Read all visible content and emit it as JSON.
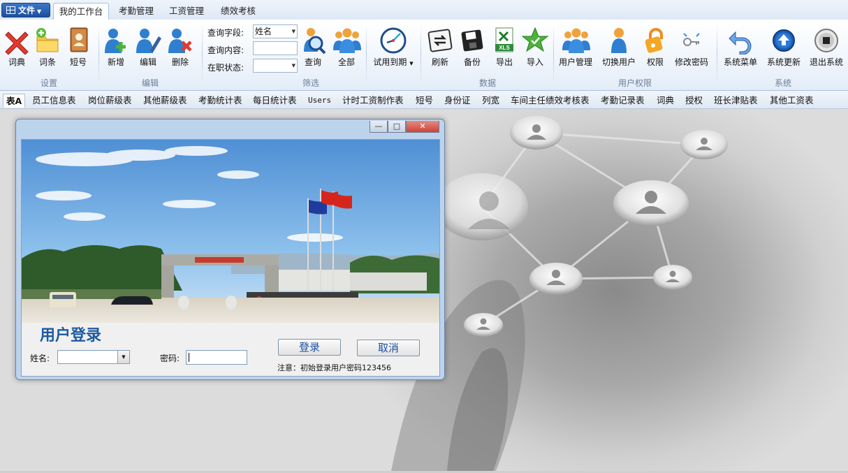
{
  "menu": {
    "file_label": "文件",
    "tabs": [
      "我的工作台",
      "考勤管理",
      "工资管理",
      "绩效考核"
    ]
  },
  "ribbon": {
    "groups": {
      "settings": "设置",
      "edit": "编辑",
      "filter": "筛选",
      "data": "数据",
      "user": "用户权限",
      "system": "系统"
    },
    "buttons": {
      "dictionary": "词典",
      "entries": "词条",
      "sms": "短号",
      "add": "新增",
      "edit": "编辑",
      "delete": "删除",
      "query": "查询",
      "all": "全部",
      "probation": "试用到期",
      "refresh": "刷新",
      "backup": "备份",
      "export": "导出",
      "import": "导入",
      "user_manage": "用户管理",
      "switch_user": "切换用户",
      "permission": "权限",
      "change_password": "修改密码",
      "system_menu": "系统菜单",
      "system_update": "系统更新",
      "exit": "退出系统"
    },
    "filter": {
      "field_label": "查询字段:",
      "field_value": "姓名",
      "content_label": "查询内容:",
      "content_value": "",
      "status_label": "在职状态:",
      "status_value": ""
    },
    "xls_badge": "XLS"
  },
  "sheet_tabs": [
    "表A",
    "员工信息表",
    "岗位薪级表",
    "其他薪级表",
    "考勤统计表",
    "每日统计表",
    "Users",
    "计时工资制作表",
    "短号",
    "身份证",
    "列宽",
    "车间主任绩效考核表",
    "考勤记录表",
    "词典",
    "授权",
    "班长津贴表",
    "其他工资表"
  ],
  "login": {
    "title": "用户登录",
    "name_label": "姓名:",
    "name_value": "",
    "password_label": "密码:",
    "password_value": "",
    "login_button": "登录",
    "cancel_button": "取消",
    "note": "注意：初始登录用户密码123456",
    "window_controls": [
      "—",
      "□",
      "✕"
    ]
  },
  "colors": {
    "accent": "#1c4f9e",
    "title_blue": "#1d5aa0",
    "close_red": "#c9443a"
  }
}
